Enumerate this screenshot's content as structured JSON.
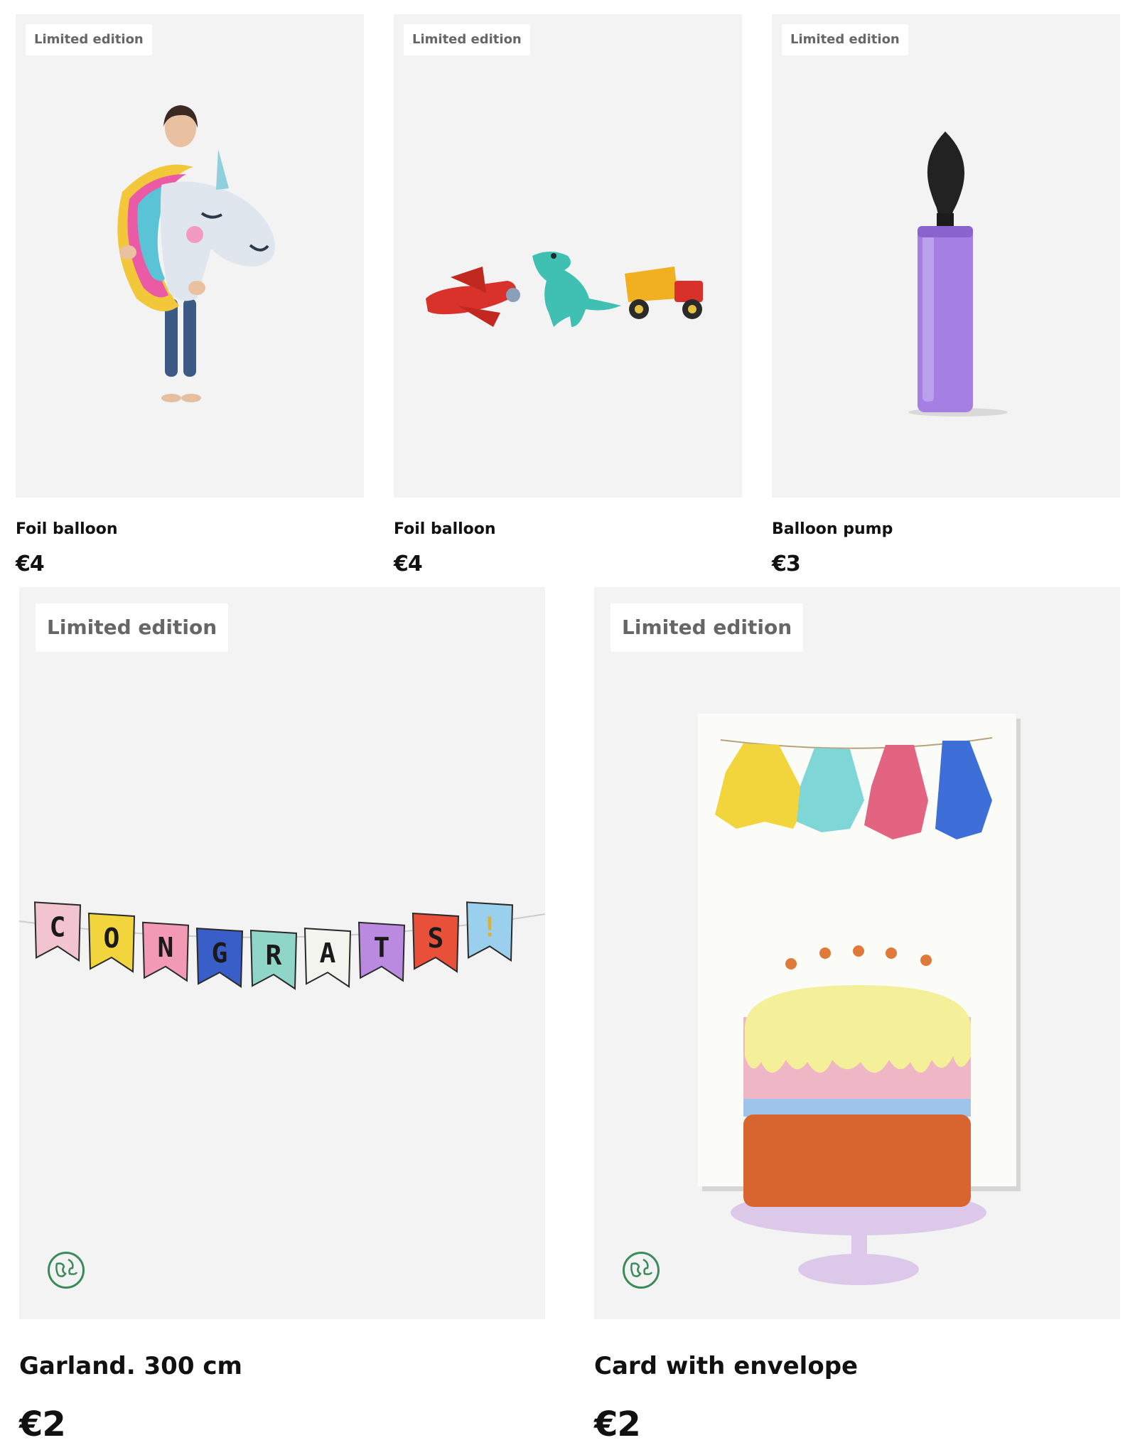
{
  "products": [
    {
      "badge": "Limited edition",
      "name": "Foil balloon",
      "price": "€4",
      "image": "unicorn-foil-balloon-held-by-child"
    },
    {
      "badge": "Limited edition",
      "name": "Foil balloon",
      "price": "€4",
      "image": "airplane-dinosaur-truck-foil-balloons"
    },
    {
      "badge": "Limited edition",
      "name": "Balloon pump",
      "price": "€3",
      "image": "purple-balloon-pump"
    },
    {
      "badge": "Limited edition",
      "name": "Garland. 300 cm",
      "price": "€2",
      "image": "congrats-pennant-garland",
      "eco_icon": "globe-eco-icon"
    },
    {
      "badge": "Limited edition",
      "name": "Card with envelope",
      "price": "€2",
      "image": "cake-tassel-greeting-card",
      "eco_icon": "globe-eco-icon"
    }
  ],
  "garland_letters": [
    "C",
    "O",
    "N",
    "G",
    "R",
    "A",
    "T",
    "S",
    "!"
  ],
  "colors": {
    "image_bg": "#f3f3f3",
    "badge_text": "#666666",
    "eco_green": "#3a8a5a"
  }
}
